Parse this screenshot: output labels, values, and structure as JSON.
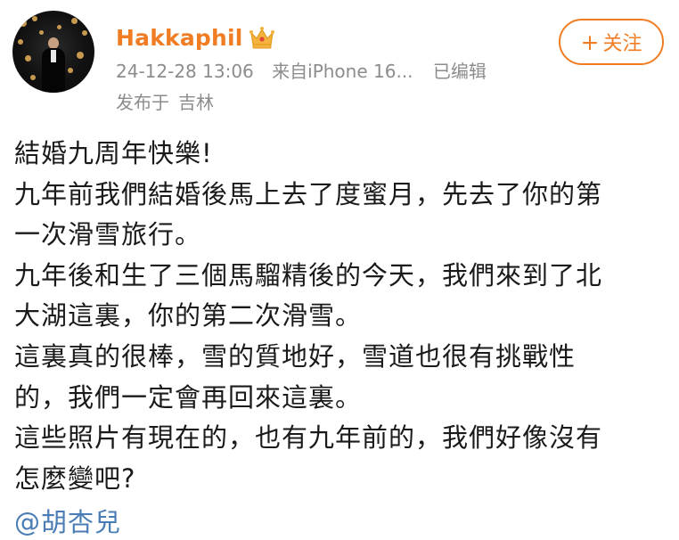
{
  "user": {
    "name": "Hakkaphil",
    "badge": "crown-badge-icon",
    "avatar": "avatar-photo"
  },
  "post_meta": {
    "timestamp": "24-12-28 13:06",
    "source": "来自iPhone 16...",
    "edited": "已编辑",
    "location_label": "发布于",
    "location": "吉林"
  },
  "follow_button": {
    "plus": "+",
    "label": "关注"
  },
  "content": {
    "lines": [
      "結婚九周年快樂!",
      "九年前我們結婚後馬上去了度蜜月，先去了你的第",
      "一次滑雪旅行。",
      "九年後和生了三個馬騮精後的今天，我們來到了北",
      "大湖這裏，你的第二次滑雪。",
      "這裏真的很棒，雪的質地好，雪道也很有挑戰性",
      "的，我們一定會再回來這裏。",
      "這些照片有現在的，也有九年前的，我們好像沒有",
      "怎麼變吧?"
    ],
    "mention": "@胡杏兒"
  },
  "colors": {
    "accent": "#f07d24",
    "meta": "#8c8c8c",
    "text": "#1a1a1a",
    "mention": "#4a7cb5"
  }
}
